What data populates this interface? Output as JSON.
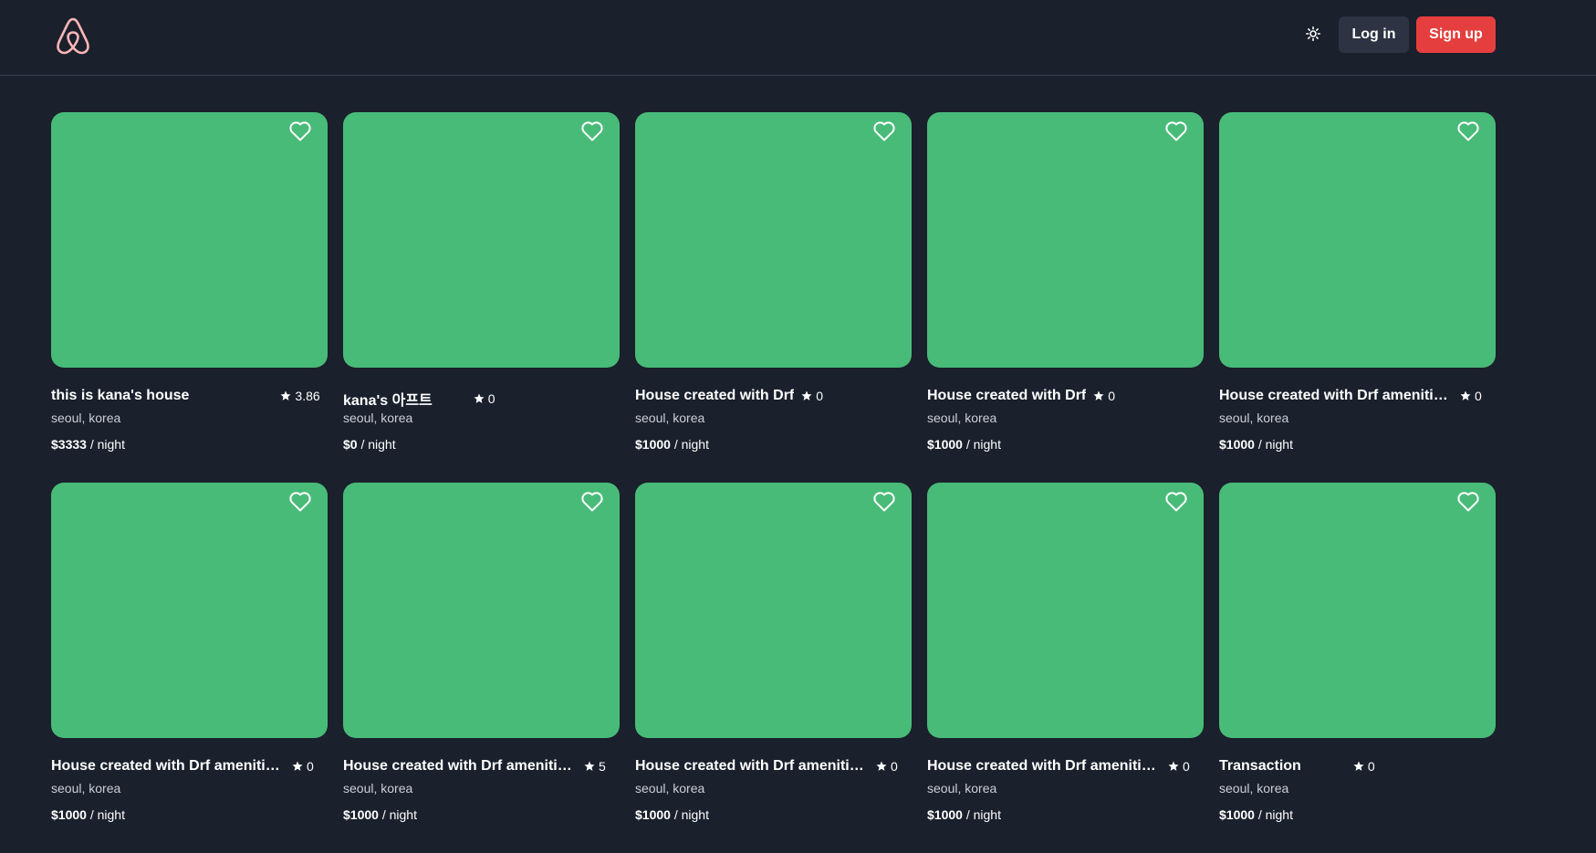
{
  "header": {
    "login_label": "Log in",
    "signup_label": "Sign up",
    "brand_color": "#e53e3e",
    "logo_color": "#fbb6b6"
  },
  "listings": [
    {
      "title": "this is kana's house",
      "rating": "3.86",
      "location": "seoul, korea",
      "price": "$3333",
      "per": "/ night"
    },
    {
      "title": "kana's 아프트",
      "rating": "0",
      "location": "seoul, korea",
      "price": "$0",
      "per": "/ night"
    },
    {
      "title": "House created with Drf",
      "rating": "0",
      "location": "seoul, korea",
      "price": "$1000",
      "per": "/ night"
    },
    {
      "title": "House created with Drf",
      "rating": "0",
      "location": "seoul, korea",
      "price": "$1000",
      "per": "/ night"
    },
    {
      "title": "House created with Drf amenities",
      "rating": "0",
      "location": "seoul, korea",
      "price": "$1000",
      "per": "/ night"
    },
    {
      "title": "House created with Drf amenities",
      "rating": "0",
      "location": "seoul, korea",
      "price": "$1000",
      "per": "/ night"
    },
    {
      "title": "House created with Drf amenities",
      "rating": "5",
      "location": "seoul, korea",
      "price": "$1000",
      "per": "/ night"
    },
    {
      "title": "House created with Drf amenities",
      "rating": "0",
      "location": "seoul, korea",
      "price": "$1000",
      "per": "/ night"
    },
    {
      "title": "House created with Drf amenities",
      "rating": "0",
      "location": "seoul, korea",
      "price": "$1000",
      "per": "/ night"
    },
    {
      "title": "Transaction",
      "rating": "0",
      "location": "seoul, korea",
      "price": "$1000",
      "per": "/ night"
    }
  ],
  "colors": {
    "background": "#1a202c",
    "thumbnail": "#48bb78"
  }
}
